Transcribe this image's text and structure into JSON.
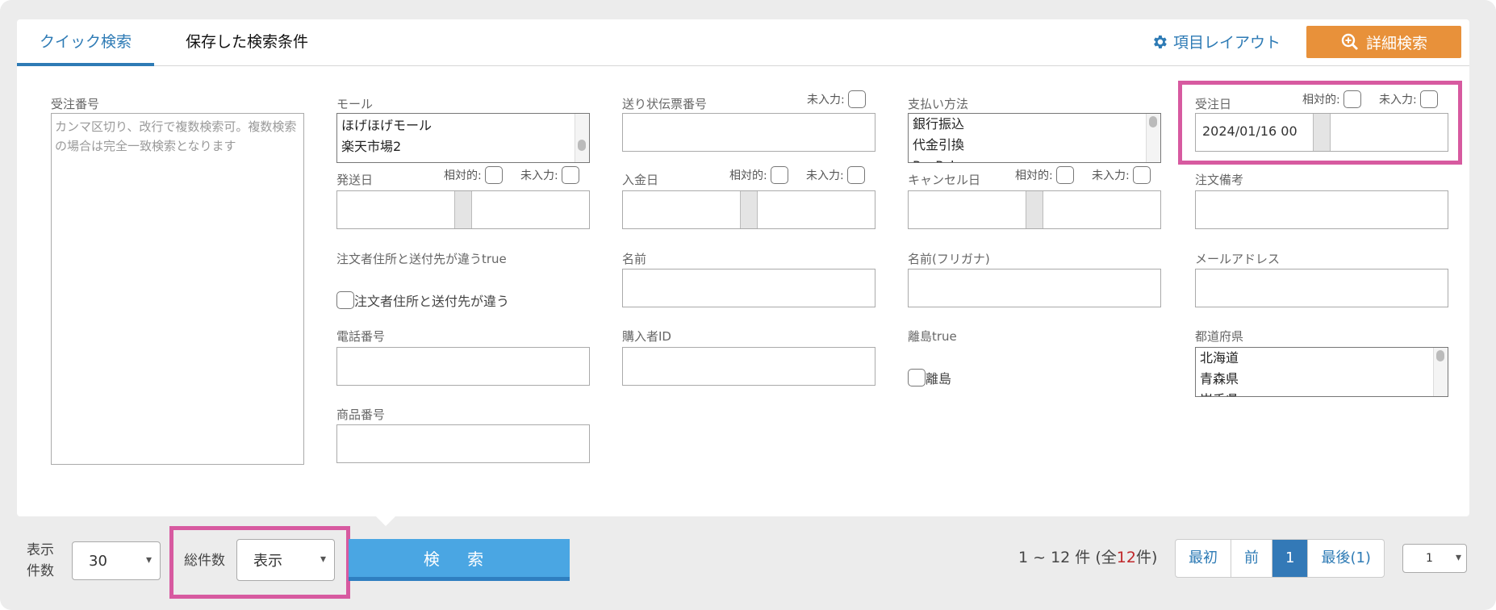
{
  "tabs": {
    "quick": "クイック検索",
    "saved": "保存した検索条件"
  },
  "header": {
    "layout_link": "項目レイアウト",
    "advanced_button": "詳細検索"
  },
  "fields": {
    "order_number": {
      "label": "受注番号",
      "placeholder": "カンマ区切り、改行で複数検索可。複数検索の場合は完全一致検索となります"
    },
    "mall": {
      "label": "モール",
      "options": [
        "ほげほげモール",
        "楽天市場2"
      ]
    },
    "tracking": {
      "label": "送り状伝票番号",
      "empty_label": "未入力:"
    },
    "payment": {
      "label": "支払い方法",
      "options": [
        "銀行振込",
        "代金引換",
        "PayPal"
      ]
    },
    "order_date": {
      "label": "受注日",
      "relative_label": "相対的:",
      "empty_label": "未入力:",
      "value": "2024/01/16 00"
    },
    "ship_date": {
      "label": "発送日",
      "relative_label": "相対的:",
      "empty_label": "未入力:"
    },
    "payment_date": {
      "label": "入金日",
      "relative_label": "相対的:",
      "empty_label": "未入力:"
    },
    "cancel_date": {
      "label": "キャンセル日",
      "relative_label": "相対的:",
      "empty_label": "未入力:"
    },
    "order_note": {
      "label": "注文備考"
    },
    "diff_address": {
      "label": "注文者住所と送付先が違うtrue",
      "checkbox_label": "注文者住所と送付先が違う"
    },
    "name": {
      "label": "名前"
    },
    "name_kana": {
      "label": "名前(フリガナ)"
    },
    "email": {
      "label": "メールアドレス"
    },
    "phone": {
      "label": "電話番号"
    },
    "buyer_id": {
      "label": "購入者ID"
    },
    "remote_island": {
      "label": "離島true",
      "checkbox_label": "離島"
    },
    "prefecture": {
      "label": "都道府県",
      "options": [
        "北海道",
        "青森県",
        "岩手県"
      ]
    },
    "product_number": {
      "label": "商品番号"
    }
  },
  "footer": {
    "display_label_1": "表示",
    "display_label_2": "件数",
    "per_page": "30",
    "total_label": "総件数",
    "total_select": "表示",
    "search_button": "検 索",
    "count_prefix": "1 ~ 12 件 (全",
    "count_total": "12",
    "count_suffix": "件)",
    "pager": {
      "first": "最初",
      "prev": "前",
      "current": "1",
      "last": "最後(1)"
    },
    "page_select": "1"
  },
  "colors": {
    "accent": "#2e7bb5",
    "orange": "#e8913a",
    "highlight": "#d75aa0",
    "search": "#4aa6e3"
  }
}
